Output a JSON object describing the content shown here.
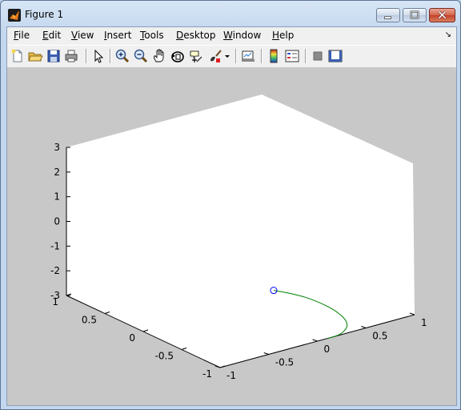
{
  "window": {
    "title": "Figure 1"
  },
  "menu": {
    "items": [
      {
        "label": "File",
        "underline": "F",
        "rest": "ile"
      },
      {
        "label": "Edit",
        "underline": "E",
        "rest": "dit"
      },
      {
        "label": "View",
        "underline": "V",
        "rest": "iew"
      },
      {
        "label": "Insert",
        "underline": "I",
        "rest": "nsert"
      },
      {
        "label": "Tools",
        "underline": "T",
        "rest": "ools"
      },
      {
        "label": "Desktop",
        "underline": "D",
        "rest": "esktop"
      },
      {
        "label": "Window",
        "underline": "W",
        "rest": "indow"
      },
      {
        "label": "Help",
        "underline": "H",
        "rest": "elp"
      }
    ]
  },
  "toolbar": {
    "icons": [
      "new-figure-icon",
      "open-file-icon",
      "save-icon",
      "print-icon",
      "edit-plot-icon",
      "zoom-in-icon",
      "zoom-out-icon",
      "pan-icon",
      "rotate-3d-icon",
      "data-cursor-icon",
      "brush-icon",
      "link-plot-icon",
      "colorbar-icon",
      "legend-icon",
      "hide-plot-tools-icon",
      "show-plot-tools-icon"
    ]
  },
  "chart_data": {
    "type": "line",
    "dimensions": 3,
    "xlim": [
      -1,
      1
    ],
    "ylim": [
      -1,
      1
    ],
    "zlim": [
      -3,
      3
    ],
    "xticks": [
      "-1",
      "-0.5",
      "0",
      "0.5",
      "1"
    ],
    "yticks": [
      "-1",
      "-0.5",
      "0",
      "0.5",
      "1"
    ],
    "zticks": [
      "-3",
      "-2",
      "-1",
      "0",
      "1",
      "2",
      "3"
    ],
    "series": [
      {
        "color": "#007f00",
        "marker_end": "circle",
        "marker_color": "#0000ff",
        "points": [
          {
            "x": 0.1,
            "y": -1.0,
            "z": -3.0
          },
          {
            "x": 0.25,
            "y": -1.0,
            "z": -3.0
          },
          {
            "x": 0.45,
            "y": -0.85,
            "z": -3.0
          },
          {
            "x": 0.55,
            "y": -0.55,
            "z": -3.0
          },
          {
            "x": 0.55,
            "y": -0.25,
            "z": -3.0
          },
          {
            "x": 0.5,
            "y": -0.05,
            "z": -3.0
          },
          {
            "x": 0.42,
            "y": 0.1,
            "z": -3.0
          }
        ]
      }
    ],
    "background": "#ffffff",
    "figure_color": "#c8c8c8"
  }
}
